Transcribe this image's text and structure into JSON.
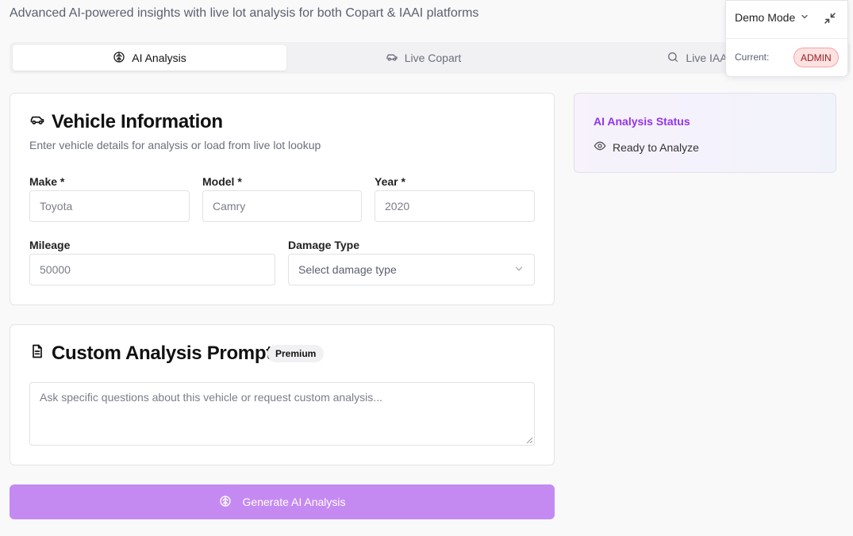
{
  "header": {
    "subtitle": "Advanced AI-powered insights with live lot analysis for both Copart & IAAI platforms"
  },
  "tabs": [
    {
      "label": "AI Analysis",
      "icon": "brain-icon",
      "active": true
    },
    {
      "label": "Live Copart",
      "icon": "car-icon",
      "active": false
    },
    {
      "label": "Live IAA",
      "icon": "search-icon",
      "active": false
    }
  ],
  "vehicle": {
    "title": "Vehicle Information",
    "description": "Enter vehicle details for analysis or load from live lot lookup",
    "make_label": "Make *",
    "make_placeholder": "Toyota",
    "model_label": "Model *",
    "model_placeholder": "Camry",
    "year_label": "Year *",
    "year_placeholder": "2020",
    "mileage_label": "Mileage",
    "mileage_placeholder": "50000",
    "damage_label": "Damage Type",
    "damage_placeholder": "Select damage type"
  },
  "prompt": {
    "title": "Custom Analysis Prompt",
    "badge": "Premium",
    "placeholder": "Ask specific questions about this vehicle or request custom analysis..."
  },
  "generate_button": {
    "label": "Generate AI Analysis"
  },
  "status": {
    "title": "AI Analysis Status",
    "text": "Ready to Analyze"
  },
  "demo": {
    "mode_label": "Demo Mode",
    "current_label": "Current:",
    "role": "ADMIN"
  },
  "colors": {
    "accent": "#9333ea",
    "button_bg": "#c58af2",
    "role_bg": "#fde2e2",
    "role_text": "#991b1b"
  }
}
